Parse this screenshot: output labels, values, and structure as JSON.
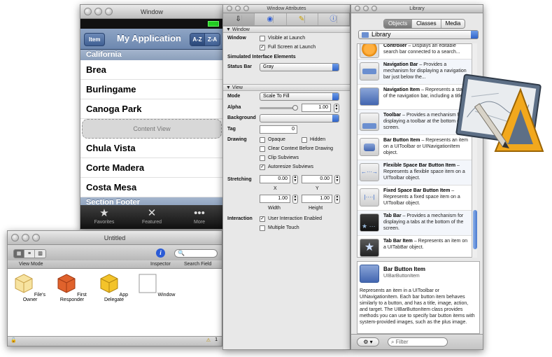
{
  "iphone_window": {
    "title": "Window",
    "nav_button": "Item",
    "nav_title": "My Application",
    "sort_segments": [
      "A-Z",
      "Z-A"
    ],
    "section_header": "California",
    "rows": [
      "Brea",
      "Burlingame",
      "Canoga Park"
    ],
    "content_view": "Content View",
    "rows2": [
      "Chula Vista",
      "Corte Madera",
      "Costa Mesa"
    ],
    "section_footer": "Section Footer",
    "tabs": [
      {
        "icon": "star-icon",
        "label": "Favorites"
      },
      {
        "icon": "featured-icon",
        "label": "Featured"
      },
      {
        "icon": "more-icon",
        "label": "More"
      }
    ]
  },
  "untitled_window": {
    "title": "Untitled",
    "view_mode_label": "View Mode",
    "inspector_label": "Inspector",
    "search_label": "Search Field",
    "objects": [
      {
        "label": "File's Owner",
        "icon": "files-owner-cube-icon",
        "color": "#f1d27a"
      },
      {
        "label": "First Responder",
        "icon": "first-responder-cube-icon",
        "color": "#e0622c"
      },
      {
        "label": "App Delegate",
        "icon": "app-delegate-cube-icon",
        "color": "#f3c32a"
      },
      {
        "label": "Window",
        "icon": "window-icon",
        "color": "#ffffff"
      }
    ],
    "warning_count": "1"
  },
  "attributes_window": {
    "title": "Window Attributes",
    "section_window": "Window",
    "window_label": "Window",
    "visible_at_launch": "Visible at Launch",
    "full_screen_at_launch": "Full Screen at Launch",
    "simulated_label": "Simulated Interface Elements",
    "status_bar_label": "Status Bar",
    "status_bar_value": "Gray",
    "section_view": "View",
    "mode_label": "Mode",
    "mode_value": "Scale To Fill",
    "alpha_label": "Alpha",
    "alpha_value": "1.00",
    "background_label": "Background",
    "tag_label": "Tag",
    "tag_value": "0",
    "drawing_label": "Drawing",
    "opaque": "Opaque",
    "hidden": "Hidden",
    "clear_context": "Clear Context Before Drawing",
    "clip_subviews": "Clip Subviews",
    "autoresize_subviews": "Autoresize Subviews",
    "stretching_label": "Stretching",
    "stretch_x": "0.00",
    "stretch_y": "0.00",
    "x_label": "X",
    "y_label": "Y",
    "stretch_width": "1.00",
    "stretch_height": "1.00",
    "width_label": "Width",
    "height_label": "Height",
    "interaction_label": "Interaction",
    "user_interaction": "User Interaction Enabled",
    "multiple_touch": "Multiple Touch"
  },
  "library_window": {
    "title": "Library",
    "segments": [
      "Objects",
      "Classes",
      "Media"
    ],
    "popup": "Library",
    "items": [
      {
        "title": "Controller",
        "desc": " – Displays an editable search bar connected to a search..."
      },
      {
        "title": "Navigation Bar",
        "desc": " – Provides a mechanism for displaying a navigation bar just below the..."
      },
      {
        "title": "Navigation Item",
        "desc": " – Represents a state of the navigation bar, including a title."
      },
      {
        "title": "Toolbar",
        "desc": " – Provides a mechanism for displaying a toolbar at the bottom of the screen."
      },
      {
        "title": "Bar Button Item",
        "desc": " – Represents an item on a UIToolbar or UINavigationItem object."
      },
      {
        "title": "Flexible Space Bar Button Item",
        "desc": " – Represents a flexible space item on a UIToolbar object."
      },
      {
        "title": "Fixed Space Bar Button Item",
        "desc": " – Represents a fixed space item on a UIToolbar object."
      },
      {
        "title": "Tab Bar",
        "desc": " – Provides a mechanism for displaying a tabs at the bottom of the screen."
      },
      {
        "title": "Tab Bar Item",
        "desc": " – Represents an item on a UITabBar object."
      }
    ],
    "detail_title": "Bar Button Item",
    "detail_subtitle": "UIBarButtonItem",
    "detail_text": "Represents an item in a UIToolbar or UINavigationItem. Each bar button item behaves similarly to a button, and has a title, image, action, and target. The UIBarButtonItem class provides methods you can use to specify bar button items with system-provided images, such as the plus image.",
    "filter_placeholder": "Filter"
  }
}
